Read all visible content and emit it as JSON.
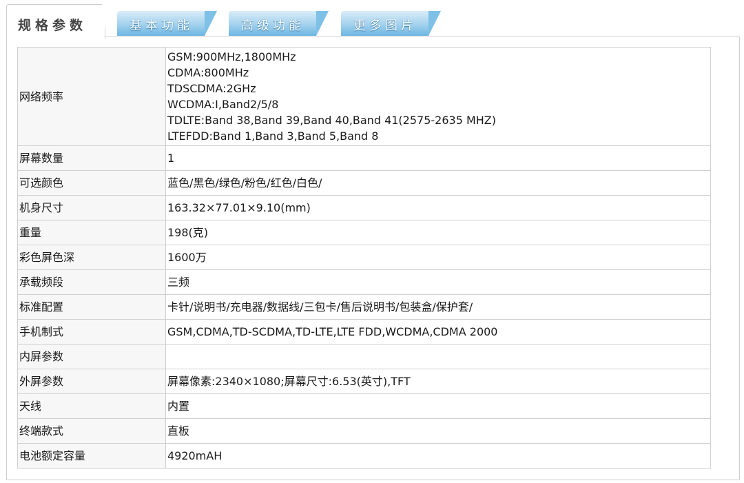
{
  "tabs": {
    "active_label": "规格参数",
    "items": [
      {
        "label": "基本功能"
      },
      {
        "label": "高级功能"
      },
      {
        "label": "更多图片"
      }
    ]
  },
  "specs": {
    "rows": [
      {
        "label": "网络频率",
        "lines": [
          "GSM:900MHz,1800MHz",
          "CDMA:800MHz",
          "TDSCDMA:2GHz",
          "WCDMA:I,Band2/5/8",
          "TDLTE:Band 38,Band 39,Band 40,Band 41(2575-2635 MHZ)",
          "LTEFDD:Band 1,Band 3,Band 5,Band 8"
        ]
      },
      {
        "label": "屏幕数量",
        "value": "1"
      },
      {
        "label": "可选颜色",
        "value": "蓝色/黑色/绿色/粉色/红色/白色/"
      },
      {
        "label": "机身尺寸",
        "value": "163.32×77.01×9.10(mm)"
      },
      {
        "label": "重量",
        "value": "198(克)"
      },
      {
        "label": "彩色屏色深",
        "value": "1600万"
      },
      {
        "label": "承载频段",
        "value": "三频"
      },
      {
        "label": "标准配置",
        "value": "卡针/说明书/充电器/数据线/三包卡/售后说明书/包装盒/保护套/"
      },
      {
        "label": "手机制式",
        "value": "GSM,CDMA,TD-SCDMA,TD-LTE,LTE FDD,WCDMA,CDMA 2000"
      },
      {
        "label": "内屏参数",
        "value": ""
      },
      {
        "label": "外屏参数",
        "value": "屏幕像素:2340×1080;屏幕尺寸:6.53(英寸),TFT"
      },
      {
        "label": "天线",
        "value": "内置"
      },
      {
        "label": "终端款式",
        "value": "直板"
      },
      {
        "label": "电池额定容量",
        "value": "4920mAH"
      }
    ]
  }
}
